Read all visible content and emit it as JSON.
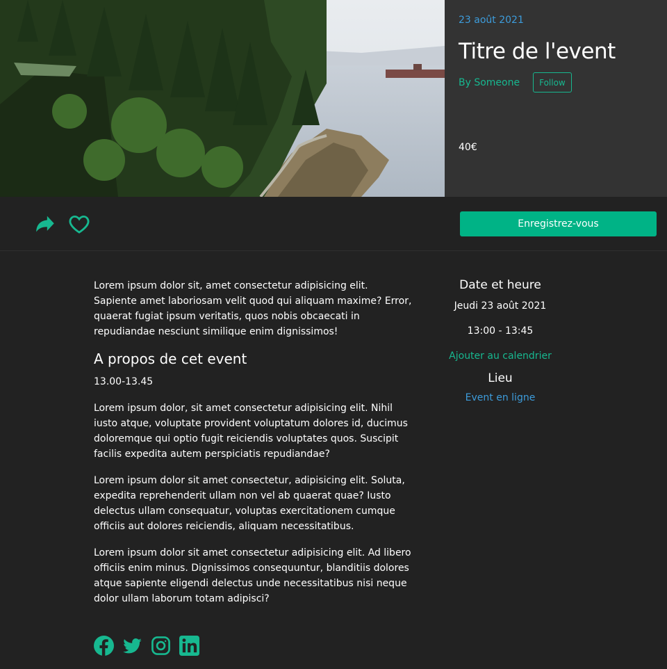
{
  "event": {
    "date": "23 août 2021",
    "title": "Titre de l'event",
    "author": "By Someone",
    "follow_label": "Follow",
    "price": "40€"
  },
  "actions": {
    "share_icon": "share-icon",
    "heart_icon": "heart-icon",
    "register_label": "Enregistrez-vous"
  },
  "main": {
    "intro": "Lorem ipsum dolor sit, amet consectetur adipisicing elit. Sapiente amet laboriosam velit quod qui aliquam maxime? Error, quaerat fugiat ipsum veritatis, quos nobis obcaecati in repudiandae nesciunt similique enim dignissimos!",
    "about_heading": "A propos de cet event",
    "about_time": "13.00-13.45",
    "paragraphs": [
      "Lorem ipsum dolor, sit amet consectetur adipisicing elit. Nihil iusto atque, voluptate provident voluptatum dolores id, ducimus doloremque qui optio fugit reiciendis voluptates quos. Suscipit facilis expedita autem perspiciatis repudiandae?",
      "Lorem ipsum dolor sit amet consectetur, adipisicing elit. Soluta, expedita reprehenderit ullam non vel ab quaerat quae? Iusto delectus ullam consequatur, voluptas exercitationem cumque officiis aut dolores reiciendis, aliquam necessitatibus.",
      "Lorem ipsum dolor sit amet consectetur adipisicing elit. Ad libero officiis enim minus. Dignissimos consequuntur, blanditiis dolores atque sapiente eligendi delectus unde necessitatibus nisi neque dolor ullam laborum totam adipisci?"
    ]
  },
  "aside": {
    "date_heading": "Date et heure",
    "day": "Jeudi 23 août 2021",
    "hours": "13:00 - 13:45",
    "calendar_link": "Ajouter au calendrier",
    "location_heading": "Lieu",
    "location": "Event en ligne"
  },
  "socials": [
    "facebook-icon",
    "twitter-icon",
    "instagram-icon",
    "linkedin-icon"
  ],
  "colors": {
    "accent": "#17b890",
    "button": "#00b386",
    "link_blue": "#3d9cdb",
    "background": "#222222",
    "panel": "#333333"
  }
}
